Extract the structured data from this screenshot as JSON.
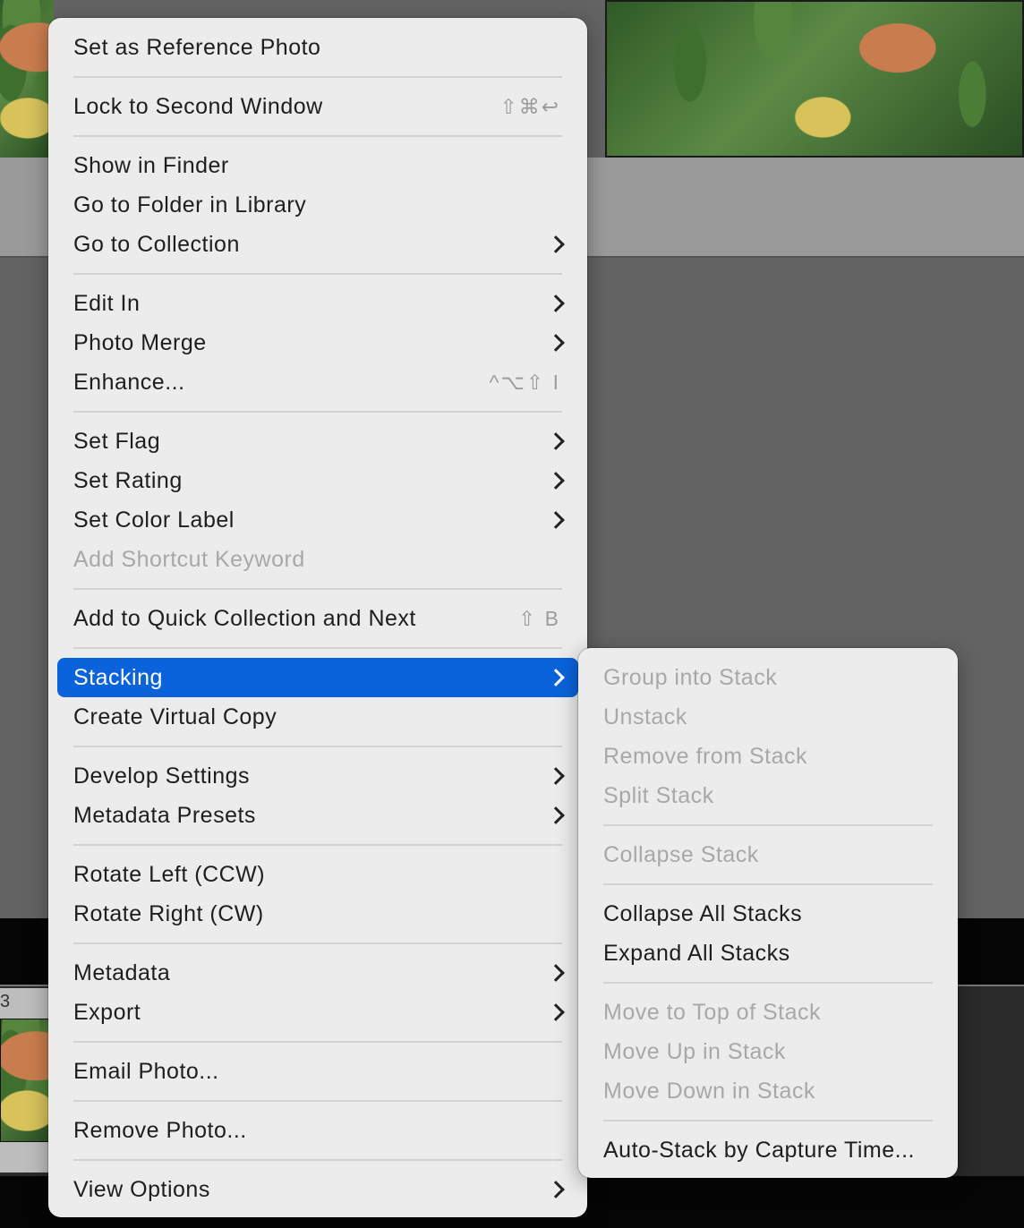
{
  "filmstrip": {
    "thumb_number": "3"
  },
  "context_menu": {
    "groups": [
      [
        {
          "label": "Set as Reference Photo"
        }
      ],
      [
        {
          "label": "Lock to Second Window",
          "shortcut": "⇧⌘↩"
        }
      ],
      [
        {
          "label": "Show in Finder"
        },
        {
          "label": "Go to Folder in Library"
        },
        {
          "label": "Go to Collection",
          "submenu": true
        }
      ],
      [
        {
          "label": "Edit In",
          "submenu": true
        },
        {
          "label": "Photo Merge",
          "submenu": true
        },
        {
          "label": "Enhance...",
          "shortcut": "^⌥⇧ I"
        }
      ],
      [
        {
          "label": "Set Flag",
          "submenu": true
        },
        {
          "label": "Set Rating",
          "submenu": true
        },
        {
          "label": "Set Color Label",
          "submenu": true
        },
        {
          "label": "Add Shortcut Keyword",
          "disabled": true
        }
      ],
      [
        {
          "label": "Add to Quick Collection and Next",
          "shortcut": "⇧ B"
        }
      ],
      [
        {
          "label": "Stacking",
          "submenu": true,
          "highlighted": true
        },
        {
          "label": "Create Virtual Copy"
        }
      ],
      [
        {
          "label": "Develop Settings",
          "submenu": true
        },
        {
          "label": "Metadata Presets",
          "submenu": true
        }
      ],
      [
        {
          "label": "Rotate Left (CCW)"
        },
        {
          "label": "Rotate Right (CW)"
        }
      ],
      [
        {
          "label": "Metadata",
          "submenu": true
        },
        {
          "label": "Export",
          "submenu": true
        }
      ],
      [
        {
          "label": "Email Photo..."
        }
      ],
      [
        {
          "label": "Remove Photo..."
        }
      ],
      [
        {
          "label": "View Options",
          "submenu": true
        }
      ]
    ]
  },
  "stacking_submenu": {
    "groups": [
      [
        {
          "label": "Group into Stack",
          "disabled": true
        },
        {
          "label": "Unstack",
          "disabled": true
        },
        {
          "label": "Remove from Stack",
          "disabled": true
        },
        {
          "label": "Split Stack",
          "disabled": true
        }
      ],
      [
        {
          "label": "Collapse Stack",
          "disabled": true
        }
      ],
      [
        {
          "label": "Collapse All Stacks"
        },
        {
          "label": "Expand All Stacks"
        }
      ],
      [
        {
          "label": "Move to Top of Stack",
          "disabled": true
        },
        {
          "label": "Move Up in Stack",
          "disabled": true
        },
        {
          "label": "Move Down in Stack",
          "disabled": true
        }
      ],
      [
        {
          "label": "Auto-Stack by Capture Time..."
        }
      ]
    ]
  },
  "colors": {
    "menu_background": "#ececec",
    "highlight": "#0a63db",
    "text": "#1e1e1e",
    "disabled_text": "#a8a8a8",
    "separator": "#d2d2d2"
  }
}
